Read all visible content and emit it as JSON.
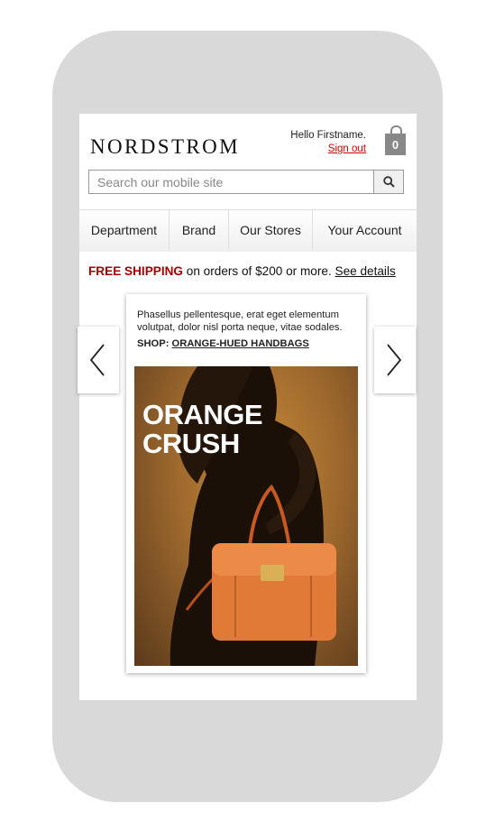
{
  "header": {
    "logo": "NORDSTROM",
    "greeting": "Hello Firstname.",
    "sign_out": "Sign out",
    "bag_count": "0"
  },
  "search": {
    "placeholder": "Search our mobile site",
    "button_icon": "search-icon"
  },
  "nav": {
    "items": [
      "Department",
      "Brand",
      "Our Stores",
      "Your Account"
    ]
  },
  "promo": {
    "highlight": "FREE SHIPPING",
    "text": " on orders of $200 or more. ",
    "link": "See details"
  },
  "card": {
    "description": "Phasellus pellentesque, erat eget elementum volutpat, dolor nisl porta neque, vitae sodales.",
    "shop_label": "SHOP: ",
    "shop_link": "ORANGE-HUED HANDBAGS",
    "hero_line1": "ORANGE",
    "hero_line2": "CRUSH"
  },
  "carousel": {
    "prev_icon": "chevron-left-icon",
    "next_icon": "chevron-right-icon"
  },
  "colors": {
    "device": "#d9d9d9",
    "promo_red": "#a00000",
    "signout_red": "#cc0000",
    "bag_gray": "#888888",
    "handbag_orange": "#e07a36"
  }
}
